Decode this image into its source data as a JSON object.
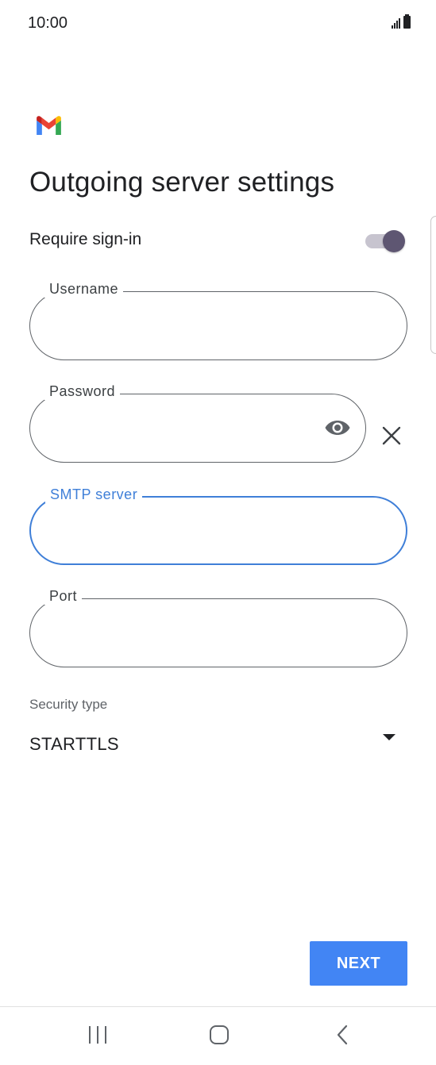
{
  "status_bar": {
    "time": "10:00"
  },
  "logo": {
    "icon": "gmail-logo"
  },
  "title": "Outgoing server settings",
  "require_signin": {
    "label": "Require sign-in",
    "enabled": true
  },
  "fields": {
    "username": {
      "label": "Username",
      "value": ""
    },
    "password": {
      "label": "Password",
      "value": "",
      "toggle_icon": "eye-icon"
    },
    "smtp_server": {
      "label": "SMTP server",
      "value": "",
      "focused": true
    },
    "port": {
      "label": "Port",
      "value": ""
    }
  },
  "security": {
    "label": "Security type",
    "value": "STARTTLS"
  },
  "next_label": "NEXT",
  "nav": {
    "recents_icon": "recents-icon",
    "home_icon": "home-icon",
    "back_icon": "back-icon"
  },
  "colors": {
    "accent": "#4285f4",
    "focus": "#3f7fd8",
    "toggle_thumb": "#5e5672"
  }
}
